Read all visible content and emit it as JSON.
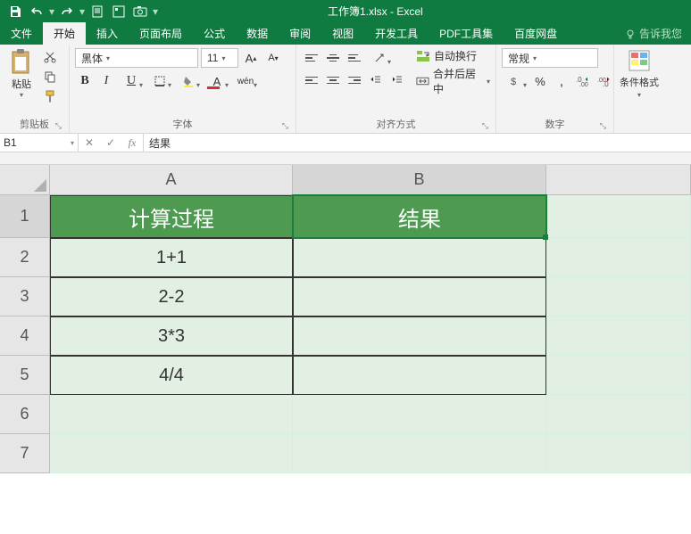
{
  "title": "工作簿1.xlsx - Excel",
  "tabs": {
    "file": "文件",
    "home": "开始",
    "insert": "插入",
    "layout": "页面布局",
    "formulas": "公式",
    "data": "数据",
    "review": "审阅",
    "view": "视图",
    "dev": "开发工具",
    "pdf": "PDF工具集",
    "baidu": "百度网盘",
    "tell": "告诉我您"
  },
  "ribbon": {
    "clipboard": {
      "paste": "粘贴",
      "label": "剪贴板"
    },
    "font": {
      "name": "黑体",
      "size": "11",
      "label": "字体",
      "wen": "wén"
    },
    "align": {
      "wrap": "自动换行",
      "merge": "合并后居中",
      "label": "对齐方式"
    },
    "number": {
      "format": "常规",
      "label": "数字"
    },
    "styles": {
      "cond": "条件格式"
    }
  },
  "namebox": "B1",
  "formula": "结果",
  "columns": [
    "A",
    "B"
  ],
  "rows": [
    "1",
    "2",
    "3",
    "4",
    "5",
    "6",
    "7"
  ],
  "cells": {
    "A1": "计算过程",
    "B1": "结果",
    "A2": "1+1",
    "A3": "2-2",
    "A4": "3*3",
    "A5": "4/4"
  },
  "chart_data": {
    "type": "table",
    "columns": [
      "计算过程",
      "结果"
    ],
    "rows": [
      [
        "1+1",
        ""
      ],
      [
        "2-2",
        ""
      ],
      [
        "3*3",
        ""
      ],
      [
        "4/4",
        ""
      ]
    ]
  }
}
